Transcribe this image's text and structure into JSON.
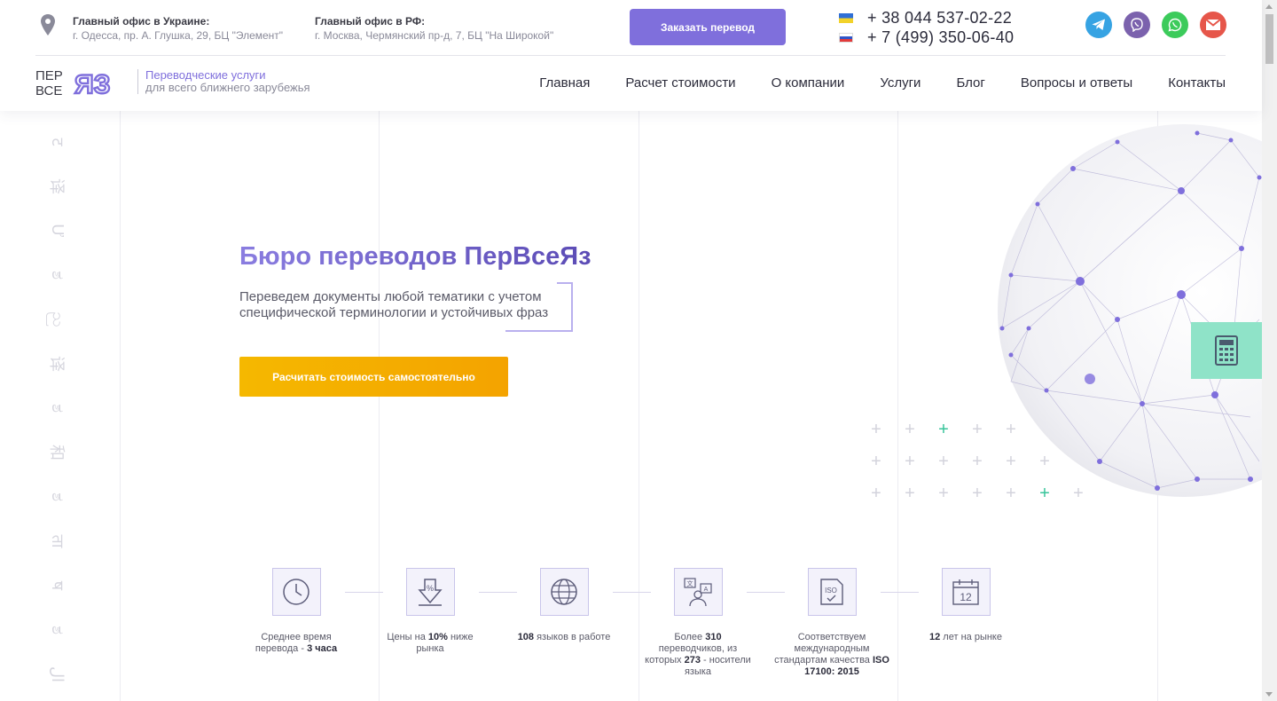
{
  "header": {
    "ukraine_office": {
      "title": "Главный офис в Украине:",
      "address": "г. Одесса, пр. А. Глушка, 29, БЦ \"Элемент\""
    },
    "russia_office": {
      "title": "Главный офис в РФ:",
      "address": "г. Москва, Чермянский пр-д, 7, БЦ \"На Широкой\""
    },
    "order_button": "Заказать перевод",
    "phones": [
      "+ 38 044 537-02-22",
      "+ 7 (499) 350-06-40"
    ],
    "socials": [
      {
        "name": "telegram-icon",
        "color": "#36a3e3"
      },
      {
        "name": "viber-icon",
        "color": "#7b62ad"
      },
      {
        "name": "whatsapp-icon",
        "color": "#3ccb5b"
      },
      {
        "name": "gmail-icon",
        "color": "#e6564a"
      }
    ],
    "logo": {
      "line1": "ПЕР",
      "line2": "ВСЕ",
      "mark": "ЯЗ"
    },
    "tagline": {
      "line1": "Переводческие услуги",
      "line2": "для всего ближнего зарубежья"
    },
    "nav": [
      "Главная",
      "Расчет стоимости",
      "О компании",
      "Услуги",
      "Блог",
      "Вопросы и ответы",
      "Контакты"
    ]
  },
  "side_glyphs": [
    "ट",
    "译",
    "Ư",
    "ಶ",
    "ည",
    "译",
    "ಶ",
    "和",
    "ಶ",
    "ता",
    "ष",
    "ಶ",
    "ال",
    "ट"
  ],
  "hero": {
    "title": "Бюро переводов ПерВсеЯз",
    "subtitle": "Переведем документы любой тематики с учетом специфической терминологии и устойчивых фраз",
    "button": "Расчитать стоимость самостоятельно"
  },
  "calculator_widget": {
    "icon": "calculator-icon",
    "color": "#8fe3c8"
  },
  "features": [
    {
      "icon": "clock-icon",
      "pre": "Среднее время перевода - ",
      "bold": "3 часа",
      "post": ""
    },
    {
      "icon": "percent-down-icon",
      "pre": "Цены на ",
      "bold": "10%",
      "post": " ниже рынка"
    },
    {
      "icon": "globe-icon",
      "pre": "",
      "bold": "108",
      "post": " языков в работе"
    },
    {
      "icon": "translator-icon",
      "pre": "Более ",
      "bold": "310",
      "post": " переводчиков, из которых ",
      "bold2": "273",
      "post2": " - носители языка"
    },
    {
      "icon": "iso-icon",
      "pre": "Соответствуем международным стандартам качества ",
      "bold": "ISO 17100: 2015",
      "post": ""
    },
    {
      "icon": "calendar-icon",
      "pre": "",
      "bold": "12",
      "post": " лет на рынке",
      "calendar_number": "12"
    }
  ],
  "colors": {
    "accent": "#7f6fdc",
    "cta": "#f5b800",
    "mint": "#8fe3c8"
  }
}
